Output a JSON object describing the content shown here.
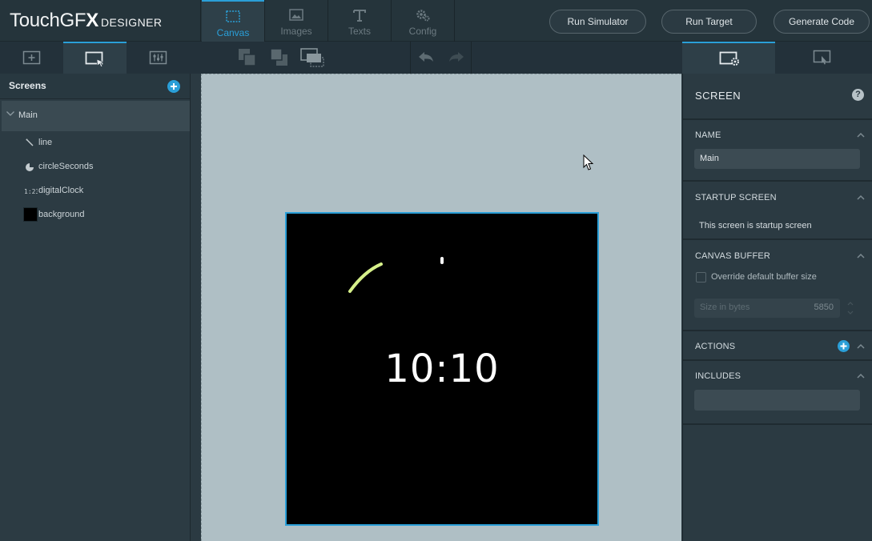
{
  "app": {
    "logo_brand": "TouchGF",
    "logo_x": "X",
    "logo_sub": "DESIGNER"
  },
  "top_tabs": [
    {
      "label": "Canvas",
      "icon": "canvas-icon",
      "active": true
    },
    {
      "label": "Images",
      "icon": "images-icon",
      "active": false
    },
    {
      "label": "Texts",
      "icon": "texts-icon",
      "active": false
    },
    {
      "label": "Config",
      "icon": "config-icon",
      "active": false
    }
  ],
  "actions": {
    "run_simulator": "Run Simulator",
    "run_target": "Run Target",
    "generate_code": "Generate Code"
  },
  "left_panel": {
    "title": "Screens",
    "tree": {
      "screen": "Main",
      "widgets": [
        {
          "label": "line",
          "icon": "line-icon"
        },
        {
          "label": "circleSeconds",
          "icon": "circle-icon"
        },
        {
          "label": "digitalClock",
          "icon": "digital-clock-icon"
        },
        {
          "label": "background",
          "icon": "box-icon"
        }
      ]
    }
  },
  "canvas": {
    "clock_text": "10:10"
  },
  "right_panel": {
    "title": "SCREEN",
    "help": "?",
    "name_section": {
      "title": "NAME",
      "value": "Main"
    },
    "startup_section": {
      "title": "STARTUP SCREEN",
      "text": "This screen is startup screen"
    },
    "buffer_section": {
      "title": "CANVAS BUFFER",
      "checkbox_label": "Override default buffer size",
      "size_placeholder": "Size in bytes",
      "size_value": "5850"
    },
    "actions_section": {
      "title": "ACTIONS"
    },
    "includes_section": {
      "title": "INCLUDES",
      "value": ""
    }
  },
  "colors": {
    "accent": "#2a9fd8",
    "arc": "#d6f08a",
    "canvas_bg": "#afbfc5"
  }
}
